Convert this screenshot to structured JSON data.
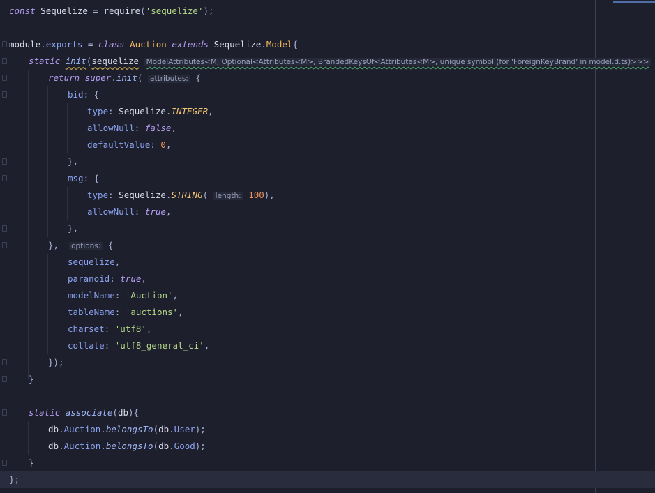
{
  "editor": {
    "lines": {
      "l1": {
        "kw": "const",
        "name": "Sequelize",
        "eq": " = ",
        "req": "require",
        "open": "(",
        "str": "'sequelize'",
        "close": ");"
      },
      "l3": {
        "mod": "module",
        "dot": ".",
        "exports": "exports",
        "eq": " = ",
        "kw1": "class",
        "cls": "Auction",
        "kw2": "extends",
        "base": "Sequelize",
        "dot2": ".",
        "model": "Model",
        "brace": "{"
      },
      "l4": {
        "kw": "static",
        "fn": "init",
        "open": "(",
        "param": "sequelize",
        "hint": "ModelAttributes<M, Optional<Attributes<M>, BrandedKeysOf<Attributes<M>, unique symbol (for 'ForeignKeyBrand' in model.d.ts)>>>",
        "close": "){"
      },
      "l5": {
        "kw1": "return",
        "kw2": "super",
        "dot": ".",
        "fn": "init",
        "open": "(",
        "hint": "attributes:",
        "brace": "{"
      },
      "l6": {
        "prop": "bid",
        "rest": ": {"
      },
      "l7": {
        "prop": "type",
        "colon": ": ",
        "obj": "Sequelize",
        "dot": ".",
        "const": "INTEGER",
        "comma": ","
      },
      "l8": {
        "prop": "allowNull",
        "colon": ": ",
        "val": "false",
        "comma": ","
      },
      "l9": {
        "prop": "defaultValue",
        "colon": ": ",
        "val": "0",
        "comma": ","
      },
      "l10": {
        "text": "},"
      },
      "l11": {
        "prop": "msg",
        "rest": ": {"
      },
      "l12": {
        "prop": "type",
        "colon": ": ",
        "obj": "Sequelize",
        "dot": ".",
        "const": "STRING",
        "open": "(",
        "hint": "length:",
        "num": "100",
        "close": "),"
      },
      "l13": {
        "prop": "allowNull",
        "colon": ": ",
        "val": "true",
        "comma": ","
      },
      "l14": {
        "text": "},"
      },
      "l15": {
        "text": "},",
        "hint": "options:",
        "brace": "{"
      },
      "l16": {
        "prop": "sequelize",
        "comma": ","
      },
      "l17": {
        "prop": "paranoid",
        "colon": ": ",
        "val": "true",
        "comma": ","
      },
      "l18": {
        "prop": "modelName",
        "colon": ": ",
        "val": "'Auction'",
        "comma": ","
      },
      "l19": {
        "prop": "tableName",
        "colon": ": ",
        "val": "'auctions'",
        "comma": ","
      },
      "l20": {
        "prop": "charset",
        "colon": ": ",
        "val": "'utf8'",
        "comma": ","
      },
      "l21": {
        "prop": "collate",
        "colon": ": ",
        "val": "'utf8_general_ci'",
        "comma": ","
      },
      "l22": {
        "text": "});"
      },
      "l23": {
        "text": "}"
      },
      "l25": {
        "kw": "static",
        "fn": "associate",
        "open": "(",
        "param": "db",
        "close": "){"
      },
      "l26": {
        "db": "db",
        "dot1": ".",
        "model": "Auction",
        "dot2": ".",
        "fn": "belongsTo",
        "open": "(",
        "arg": "db",
        "dot3": ".",
        "target": "User",
        "close": ");"
      },
      "l27": {
        "db": "db",
        "dot1": ".",
        "model": "Auction",
        "dot2": ".",
        "fn": "belongsTo",
        "open": "(",
        "arg": "db",
        "dot3": ".",
        "target": "Good",
        "close": ");"
      },
      "l28": {
        "text": "}"
      },
      "l29": {
        "text": "};"
      }
    },
    "colors": {
      "background": "#1e1f2c",
      "keyword": "#b39df0",
      "string": "#b5d98a",
      "number": "#f0925f",
      "class": "#f0b860",
      "property": "#8aa3f0"
    }
  }
}
